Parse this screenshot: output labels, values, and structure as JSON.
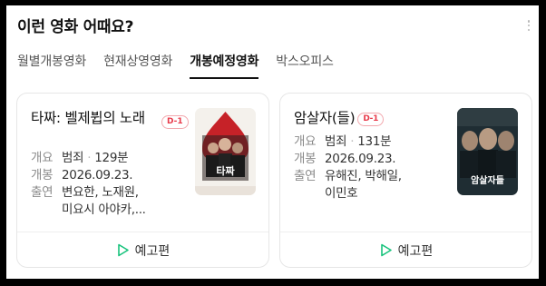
{
  "header": {
    "title": "이런 영화 어때요?"
  },
  "tabs": [
    {
      "label": "월별개봉영화"
    },
    {
      "label": "현재상영영화"
    },
    {
      "label": "개봉예정영화"
    },
    {
      "label": "박스오피스"
    }
  ],
  "active_tab": "개봉예정영화",
  "movies": [
    {
      "title": "타짜: 벨제뷥의 노래",
      "badge": "D-1",
      "genre_key": "개요",
      "genre": "범죄",
      "runtime": "129분",
      "release_key": "개봉",
      "release": "2026.09.23.",
      "cast_key": "출연",
      "cast": "변요한, 노재원,",
      "cast2": "미요시 아야카,...",
      "poster_label": "타짜",
      "trailer": "예고편"
    },
    {
      "title": "암살자(들)",
      "badge": "D-1",
      "genre_key": "개요",
      "genre": "범죄",
      "runtime": "131분",
      "release_key": "개봉",
      "release": "2026.09.23.",
      "cast_key": "출연",
      "cast": "유해진, 박해일,",
      "cast2": "이민호",
      "poster_label": "암살자들",
      "trailer": "예고편"
    }
  ],
  "colors": {
    "badge": "#e83a4a",
    "play_icon": "#19c37d",
    "poster1": "#c62228",
    "poster2": "#1f2d33"
  }
}
